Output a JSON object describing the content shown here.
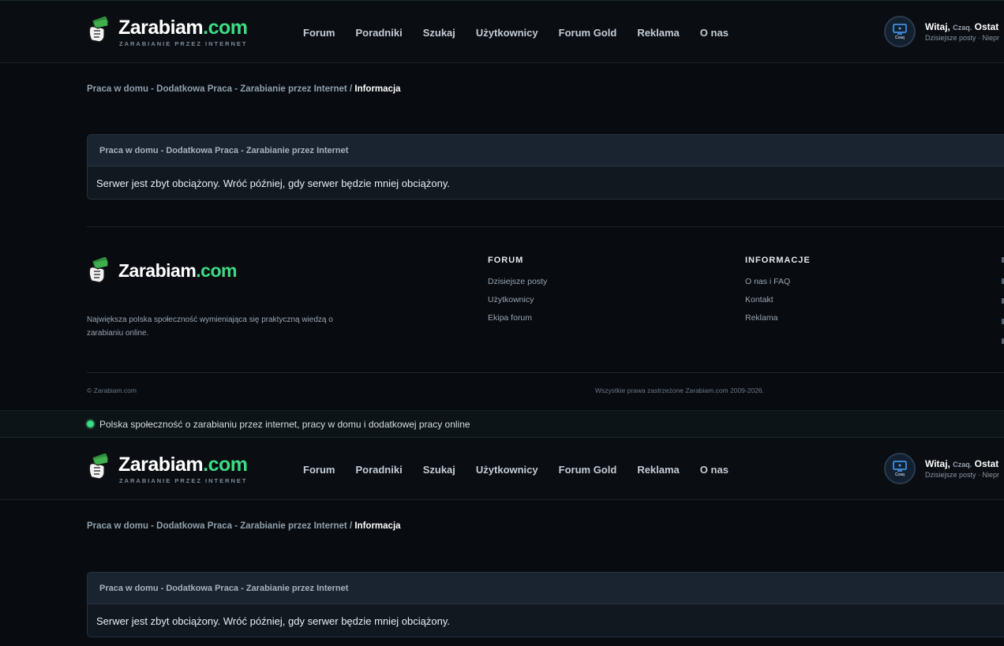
{
  "logo": {
    "title_main": "Zarabiam",
    "title_ext": ".com",
    "subtitle": "ZARABIANIE PRZEZ INTERNET"
  },
  "nav": [
    "Forum",
    "Poradniki",
    "Szukaj",
    "Użytkownicy",
    "Forum Gold",
    "Reklama",
    "O nas"
  ],
  "user": {
    "greeting": "Witaj,",
    "name": "Czaq.",
    "trail": "Ostat",
    "links": "Dzisiejsze posty · Niepr",
    "avatar_label": "Czaq"
  },
  "breadcrumb": {
    "parent": "Praca w domu - Dodatkowa Praca - Zarabianie przez Internet",
    "sep": "/",
    "current": "Informacja"
  },
  "box": {
    "title": "Praca w domu - Dodatkowa Praca - Zarabianie przez Internet",
    "message": "Serwer jest zbyt obciążony. Wróć później, gdy serwer będzie mniej obciążony."
  },
  "footer": {
    "description": "Największa polska społeczność wymieniająca się praktyczną wiedzą o zarabianiu online.",
    "col_forum": {
      "title": "FORUM",
      "links": [
        "Dzisiejsze posty",
        "Użytkownicy",
        "Ekipa forum"
      ]
    },
    "col_info": {
      "title": "INFORMACJE",
      "links": [
        "O nas i FAQ",
        "Kontakt",
        "Reklama"
      ]
    },
    "copyright": "© Zarabiam.com",
    "rights": "Wszystkie prawa zastrzeżone Zarabiam.com 2009-2026."
  },
  "tagline": "Polska społeczność o zarabianiu przez internet, pracy w domu i dodatkowej pracy online",
  "colors": {
    "accent": "#3ddc84",
    "background": "#080b10",
    "panel": "#1a2430"
  }
}
